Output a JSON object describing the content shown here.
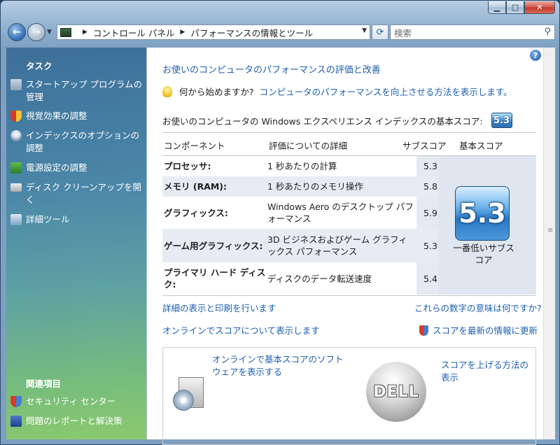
{
  "window": {
    "caption_buttons": [
      "minimize-icon",
      "maximize-icon",
      "close-icon"
    ]
  },
  "address_bar": {
    "crumbs": [
      "コントロール パネル",
      "パフォーマンスの情報とツール"
    ]
  },
  "search": {
    "placeholder": "検索"
  },
  "sidebar": {
    "tasks_heading": "タスク",
    "tasks": [
      {
        "label": "スタートアップ プログラムの管理",
        "icon": "startup-icon"
      },
      {
        "label": "視覚効果の調整",
        "icon": "shield-icon"
      },
      {
        "label": "インデックスのオプションの調整",
        "icon": "indexing-icon"
      },
      {
        "label": "電源設定の調整",
        "icon": "power-icon"
      },
      {
        "label": "ディスク クリーンアップを開く",
        "icon": "disk-cleanup-icon"
      },
      {
        "label": "詳細ツール",
        "icon": "advanced-tools-icon"
      }
    ],
    "related_heading": "関連項目",
    "related": [
      {
        "label": "セキュリティ センター",
        "icon": "security-center-icon"
      },
      {
        "label": "問題のレポートと解決策",
        "icon": "problem-reports-icon"
      }
    ]
  },
  "main": {
    "title": "お使いのコンピュータのパフォーマンスの評価と改善",
    "tip_question": "何から始めますか?",
    "tip_link": "コンピュータのパフォーマンスを向上させる方法を表示します。",
    "score_text": "お使いのコンピュータの Windows エクスペリエンス インデックスの基本スコア:",
    "base_score": "5.3",
    "table": {
      "headers": {
        "component": "コンポーネント",
        "details": "評価についての詳細",
        "subscore": "サブスコア",
        "base": "基本スコア"
      },
      "rows": [
        {
          "component": "プロセッサ:",
          "details": "1 秒あたりの計算",
          "score": "5.3"
        },
        {
          "component": "メモリ (RAM):",
          "details": "1 秒あたりのメモリ操作",
          "score": "5.8"
        },
        {
          "component": "グラフィックス:",
          "details": "Windows Aero のデスクトップ パフォーマンス",
          "score": "5.9"
        },
        {
          "component": "ゲーム用グラフィックス:",
          "details": "3D ビジネスおよびゲーム グラフィックス パフォーマンス",
          "score": "5.3"
        },
        {
          "component": "プライマリ ハード ディスク:",
          "details": "ディスクのデータ転送速度",
          "score": "5.4"
        }
      ],
      "base_badge": "5.3",
      "base_caption": "一番低いサブスコア"
    },
    "links": {
      "print_details": "詳細の表示と印刷を行います",
      "what_numbers_mean": "これらの数字の意味は何ですか?",
      "online_scores": "オンラインでスコアについて表示します",
      "update_score": "スコアを最新の情報に更新"
    },
    "bottom": {
      "software_link": "オンラインで基本スコアのソフトウェアを表示する",
      "improve_link": "スコアを上げる方法の表示",
      "logo_text": "DELL"
    }
  }
}
